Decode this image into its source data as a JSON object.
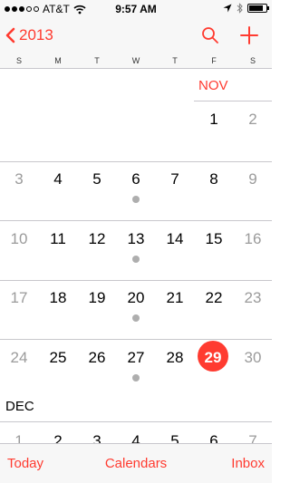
{
  "status_bar": {
    "carrier": "AT&T",
    "time": "9:57 AM",
    "signal_bars_filled": 3,
    "signal_bars_total": 5,
    "icons": [
      "wifi-icon",
      "location-arrow-icon",
      "bluetooth-icon",
      "battery-icon"
    ],
    "battery_level": 0.85
  },
  "nav": {
    "back_label": "2013",
    "back_icon": "chevron-left-icon",
    "search_icon": "search-icon",
    "add_icon": "plus-icon"
  },
  "weekdays": [
    "S",
    "M",
    "T",
    "W",
    "T",
    "F",
    "S"
  ],
  "calendar": {
    "month1_label": "NOV",
    "month2_label": "DEC",
    "nov_row1": [
      "1",
      "2"
    ],
    "nov_row2": [
      "3",
      "4",
      "5",
      "6",
      "7",
      "8",
      "9"
    ],
    "nov_row3": [
      "10",
      "11",
      "12",
      "13",
      "14",
      "15",
      "16"
    ],
    "nov_row4": [
      "17",
      "18",
      "19",
      "20",
      "21",
      "22",
      "23"
    ],
    "nov_row5": [
      "24",
      "25",
      "26",
      "27",
      "28",
      "29",
      "30"
    ],
    "dec_row1": [
      "1",
      "2",
      "3",
      "4",
      "5",
      "6",
      "7"
    ],
    "today": "29",
    "event_dot_days": [
      "6",
      "13",
      "20",
      "27"
    ]
  },
  "toolbar": {
    "today_label": "Today",
    "calendars_label": "Calendars",
    "inbox_label": "Inbox"
  },
  "colors": {
    "accent": "#ff3b30",
    "weekend_text": "#9b9b9b",
    "event_dot": "#aeaeae",
    "bar_background": "#f7f7f7",
    "separator": "#c8c7cc"
  }
}
